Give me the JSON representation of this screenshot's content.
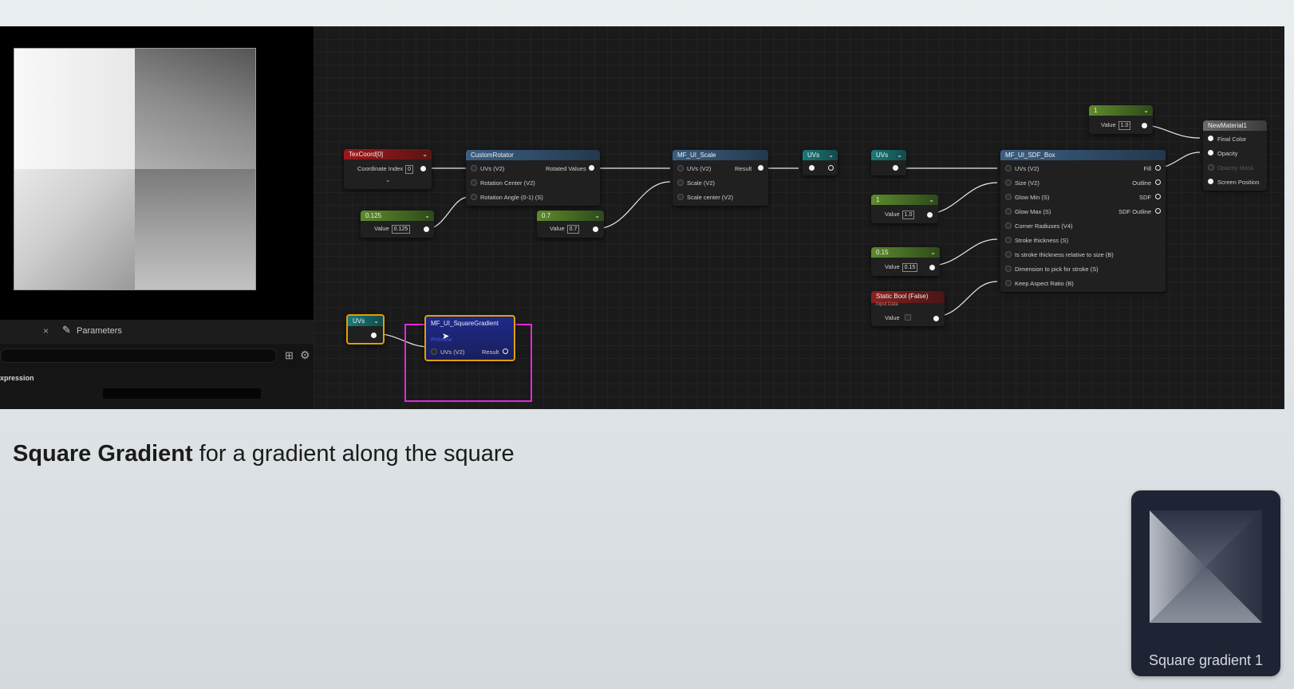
{
  "caption": {
    "bold": "Square Gradient",
    "rest": " for a gradient along the square"
  },
  "left_panel": {
    "close_glyph": "×",
    "params_tab": "Parameters",
    "search_placeholder": "",
    "expression_label": "xpression"
  },
  "nodes": {
    "texcoord": {
      "title": "TexCoord[0]",
      "row": "Coordinate Index",
      "value": "0"
    },
    "const_0125": {
      "title": "0.125",
      "label": "Value",
      "value": "0.125"
    },
    "custom_rotator": {
      "title": "CustomRotator",
      "in1": "UVs (V2)",
      "out1": "Rotated Values",
      "in2": "Rotation Center (V2)",
      "in3": "Rotation Angle (0-1) (S)"
    },
    "const_07": {
      "title": "0.7",
      "label": "Value",
      "value": "0.7"
    },
    "mf_scale": {
      "title": "MF_UI_Scale",
      "in1": "UVs (V2)",
      "out1": "Result",
      "in2": "Scale (V2)",
      "in3": "Scale center (V2)"
    },
    "uvs_reroute1": {
      "title": "UVs"
    },
    "uvs_reroute2": {
      "title": "UVs"
    },
    "const_1": {
      "title": "1",
      "label": "Value",
      "value": "1.0"
    },
    "const_015": {
      "title": "0.15",
      "label": "Value",
      "value": "0.15"
    },
    "static_bool": {
      "title": "Static Bool (False)",
      "subtitle": "Input Data",
      "label": "Value"
    },
    "mf_sdf_box": {
      "title": "MF_UI_SDF_Box",
      "inputs": [
        "UVs (V2)",
        "Size (V2)",
        "Glow Min (S)",
        "Glow Max (S)",
        "Corner Radiuses (V4)",
        "Stroke thickness (S)",
        "Is stroke thickness relative to size (B)",
        "Dimension to pick for stroke (S)",
        "Keep Aspect Ratio (B)"
      ],
      "outputs": [
        "Fill",
        "Outline",
        "SDF",
        "SDF Outline"
      ]
    },
    "const_top": {
      "title": "1",
      "label": "Value",
      "value": "1.0"
    },
    "new_material": {
      "title": "NewMaterial1",
      "pins": [
        "Final Color",
        "Opacity",
        "Opacity Mask",
        "Screen Position"
      ]
    },
    "uvs_small": {
      "title": "UVs"
    },
    "mf_square_gradient": {
      "title": "MF_UI_SquareGradient",
      "subtitle": "Preview",
      "in1": "UVs (V2)",
      "out1": "Result"
    }
  },
  "thumbnail": {
    "label": "Square gradient 1"
  }
}
